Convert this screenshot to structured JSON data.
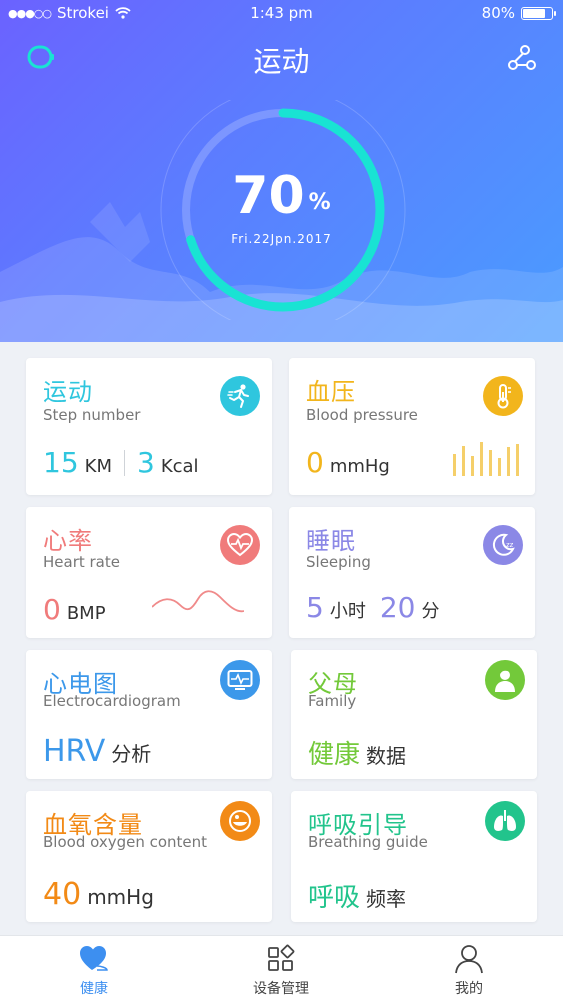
{
  "status_bar": {
    "carrier": "Strokei",
    "signal": "●●●○○",
    "time": "1:43 pm",
    "battery": "80%"
  },
  "header": {
    "title": "运动",
    "progress_value": "70",
    "progress_unit": "%",
    "progress_fraction": 0.7,
    "date": "Fri.22Jpn.2017"
  },
  "cards": {
    "sport": {
      "title": "运动",
      "subtitle": "Step number",
      "distance": "15",
      "distance_unit": "KM",
      "calories": "3",
      "calories_unit": "Kcal",
      "color": "#2fc6de",
      "icon": "running-icon"
    },
    "blood": {
      "title": "血压",
      "subtitle": "Blood pressure",
      "value": "0",
      "unit": "mmHg",
      "color": "#f2b51c",
      "icon": "thermometer-icon"
    },
    "heart": {
      "title": "心率",
      "subtitle": "Heart rate",
      "value": "0",
      "unit": "BMP",
      "color": "#f07b7b",
      "icon": "heartbeat-icon"
    },
    "sleep": {
      "title": "睡眠",
      "subtitle": "Sleeping",
      "hours": "5",
      "hours_unit": "小时",
      "minutes": "20",
      "minutes_unit": "分",
      "color": "#8b88e6",
      "icon": "moon-icon"
    },
    "ecg": {
      "title": "心电图",
      "subtitle": "Electrocardiogram",
      "value": "HRV",
      "label": "分析",
      "color": "#3c98ea",
      "icon": "monitor-icon"
    },
    "family": {
      "title": "父母",
      "subtitle": "Family",
      "value": "健康",
      "label": "数据",
      "color": "#73c93a",
      "icon": "family-icon"
    },
    "oxygen": {
      "title": "血氧含量",
      "subtitle": "Blood oxygen content",
      "value": "40",
      "unit": "mmHg",
      "color": "#f28a16",
      "icon": "cell-icon"
    },
    "breath": {
      "title": "呼吸引导",
      "subtitle": "Breathing guide",
      "value": "呼吸",
      "label": "频率",
      "color": "#22c48c",
      "icon": "lungs-icon"
    }
  },
  "tabs": [
    {
      "label": "健康",
      "icon": "heart-icon",
      "active": true
    },
    {
      "label": "设备管理",
      "icon": "devices-icon",
      "active": false
    },
    {
      "label": "我的",
      "icon": "user-icon",
      "active": false
    }
  ],
  "colors": {
    "header_start": "#6b62ff",
    "header_end": "#4a9cff",
    "ring": "#19e3d3",
    "tab_active": "#3d8ff0"
  }
}
